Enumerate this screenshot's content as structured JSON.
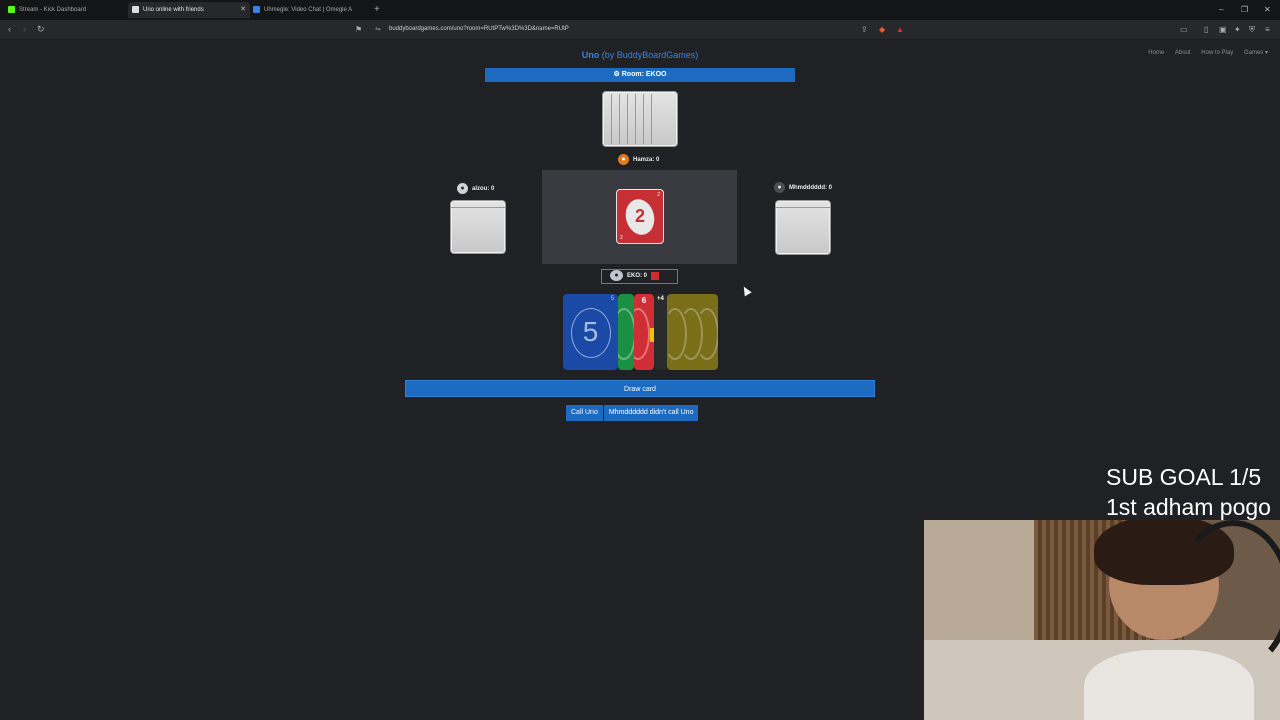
{
  "browser": {
    "tabs": [
      {
        "title": "Stream - Kick Dashboard",
        "color": "#53fc18"
      },
      {
        "title": "Uno online with friends",
        "color": "#dddddd"
      },
      {
        "title": "Uhmegle: Video Chat | Omegle A",
        "color": "#3b82e0"
      }
    ],
    "url": "buddyboardgames.com/uno?room=RUtPTw%3D%3D&name=RUtP"
  },
  "site": {
    "brand": "Uno",
    "by": " (by BuddyBoardGames)",
    "nav": [
      "Home",
      "About",
      "How to Play",
      "Games ▾"
    ]
  },
  "room": {
    "label": "⚙ Room: EKOO"
  },
  "players": {
    "top": {
      "label": "Hamza: 0"
    },
    "left": {
      "label": "alzou: 0"
    },
    "right": {
      "label": "Mhmdddddd: 0"
    },
    "me": {
      "label": "EKO: 0"
    }
  },
  "discard": {
    "value": "2",
    "color": "#c62f34"
  },
  "hand": {
    "blue": {
      "value": "5",
      "corner": "5"
    },
    "red": {
      "value": "6"
    },
    "dark": {
      "value": "+4"
    }
  },
  "actions": {
    "draw": "Draw card",
    "call_uno": "Call Uno",
    "didnt_call": "Mhmdddddd didn't call Uno"
  },
  "overlay": {
    "sub_goal": "SUB GOAL 1/5",
    "sub_line2": "1st adham pogo"
  }
}
